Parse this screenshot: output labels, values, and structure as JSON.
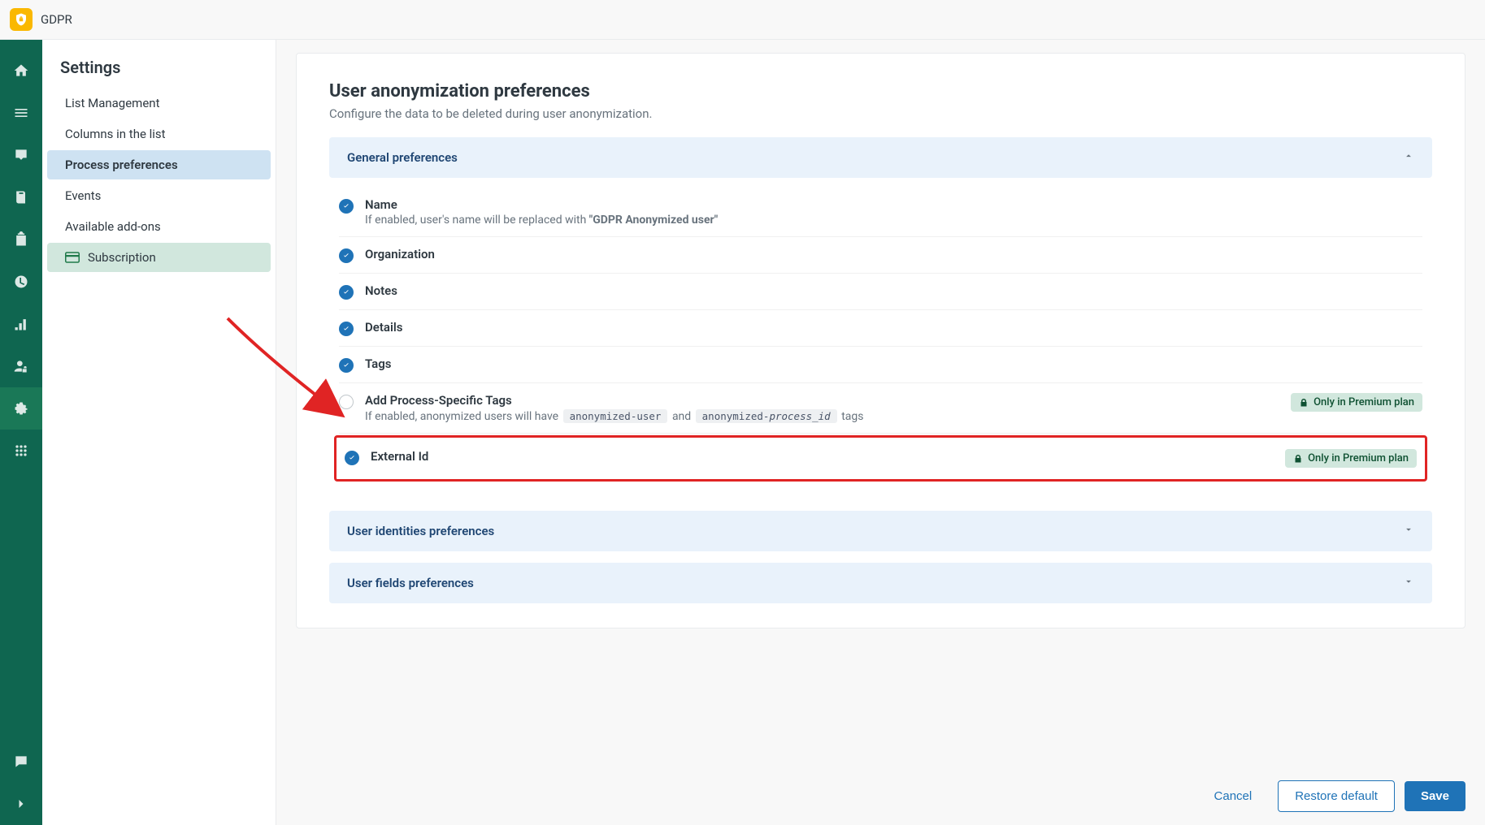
{
  "app_title": "GDPR",
  "settings_title": "Settings",
  "settings_menu": [
    {
      "label": "List Management"
    },
    {
      "label": "Columns in the list"
    },
    {
      "label": "Process preferences"
    },
    {
      "label": "Events"
    },
    {
      "label": "Available add-ons"
    },
    {
      "label": "Subscription"
    }
  ],
  "page": {
    "heading": "User anonymization preferences",
    "subtitle": "Configure the data to be deleted during user anonymization."
  },
  "accordions": {
    "general": "General preferences",
    "identities": "User identities preferences",
    "fields": "User fields preferences"
  },
  "prefs": {
    "name": {
      "title": "Name",
      "desc_prefix": "If enabled, user's name will be replaced with ",
      "desc_strong": "\"GDPR Anonymized user\""
    },
    "organization": {
      "title": "Organization"
    },
    "notes": {
      "title": "Notes"
    },
    "details": {
      "title": "Details"
    },
    "tags": {
      "title": "Tags"
    },
    "process_tags": {
      "title": "Add Process-Specific Tags",
      "desc_prefix": "If enabled, anonymized users will have ",
      "chip1": "anonymized-user",
      "mid": " and ",
      "chip2_p1": "anonymized-",
      "chip2_p2": "process_id",
      "desc_suffix": " tags"
    },
    "external_id": {
      "title": "External Id"
    }
  },
  "premium_label": "Only in Premium plan",
  "buttons": {
    "cancel": "Cancel",
    "restore": "Restore default",
    "save": "Save"
  }
}
